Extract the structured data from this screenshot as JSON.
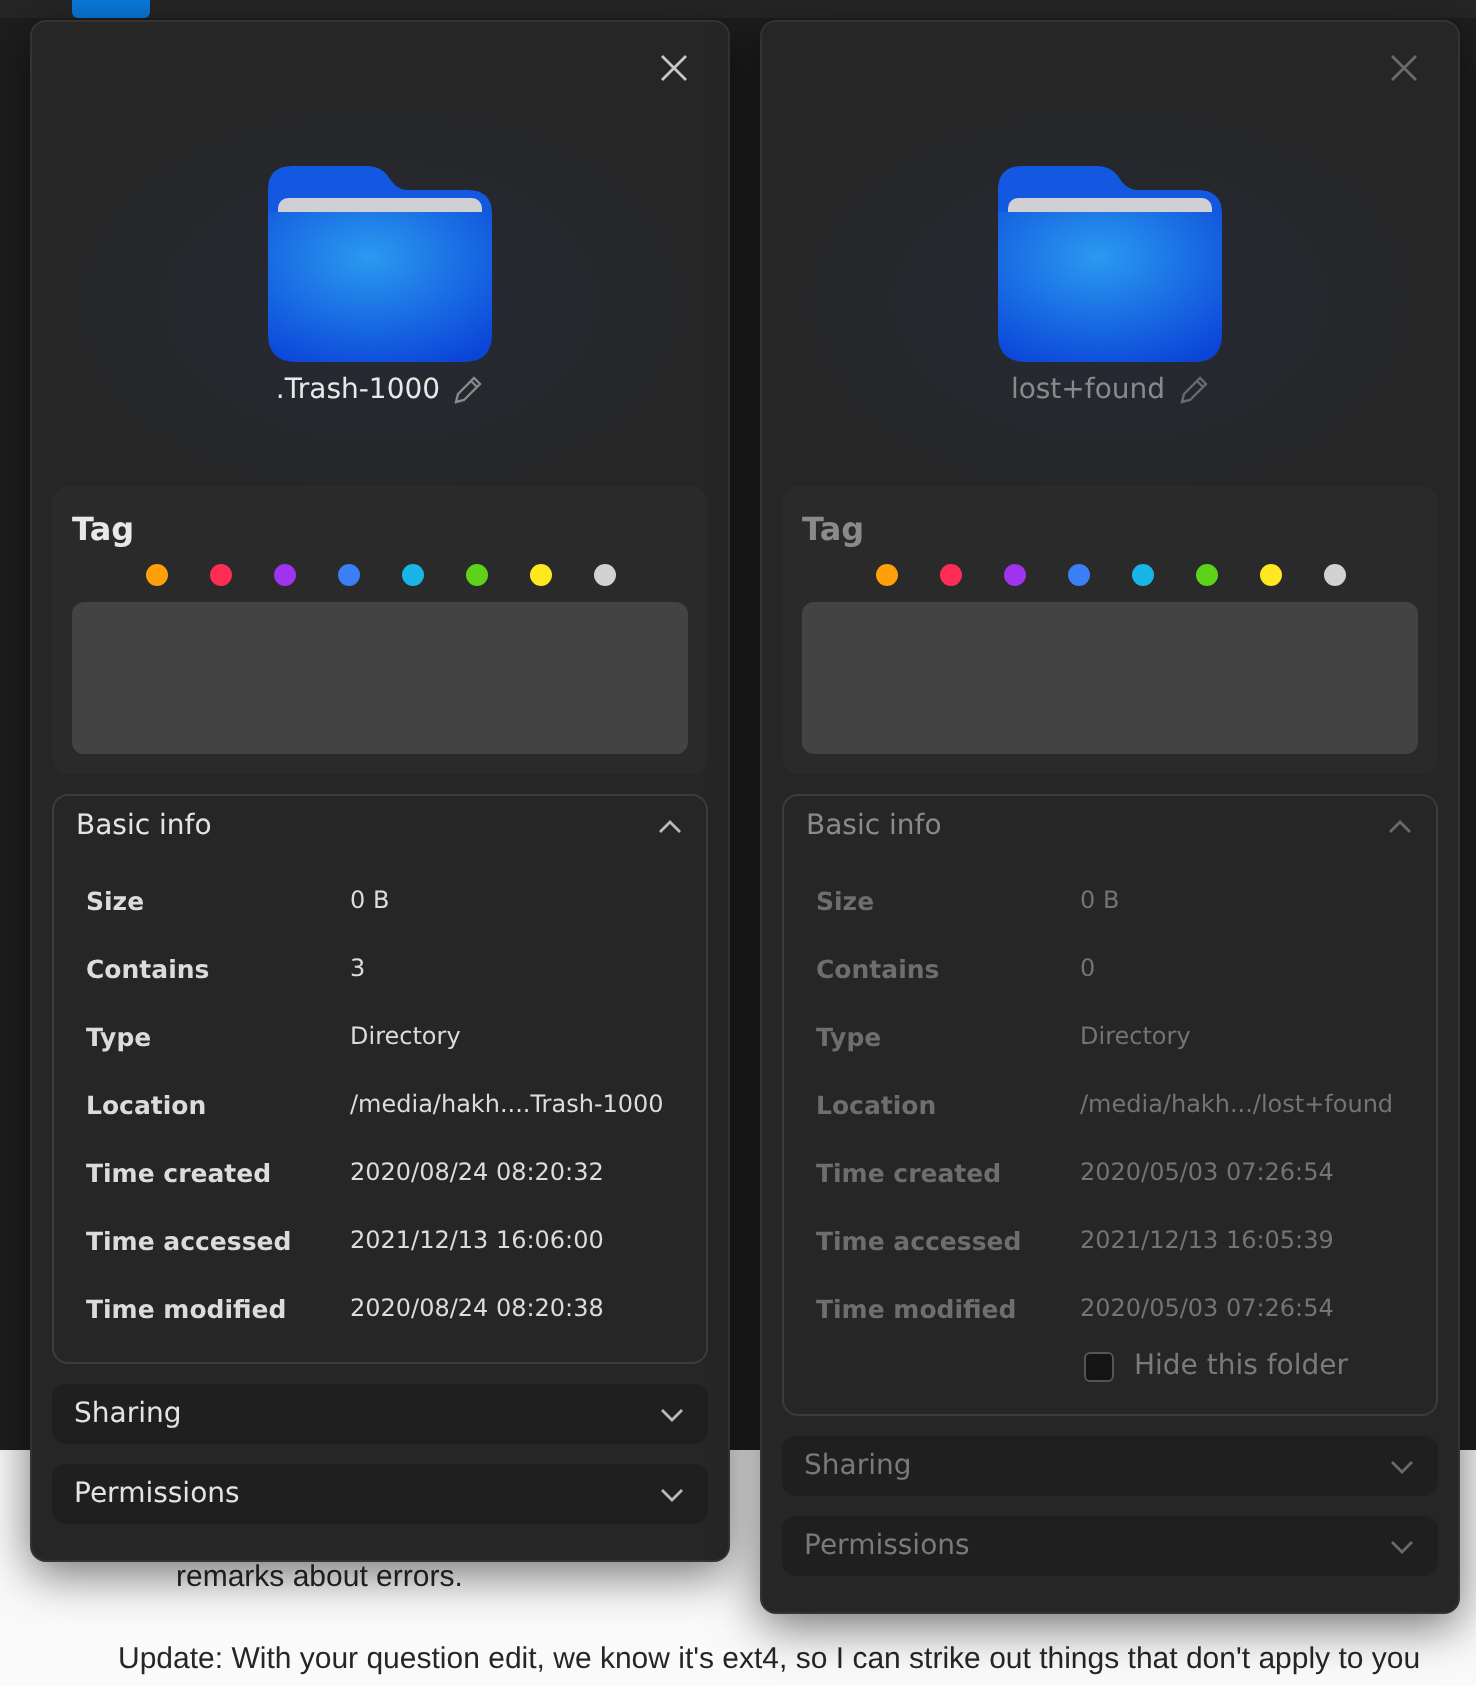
{
  "background": {
    "lines": [
      {
        "text": "remarks about errors.",
        "indent": true
      },
      {
        "text": "Update: With your question edit, we know it's ext4, so I can strike out things that don't apply to you",
        "indent": false
      }
    ]
  },
  "dialogs": [
    {
      "active": true,
      "name": ".Trash-1000",
      "tag": {
        "title": "Tag",
        "colors": [
          {
            "color": "#ff9f0a"
          },
          {
            "color": "#ff2d55"
          },
          {
            "color": "#a033f0"
          },
          {
            "color": "#3a7ff6"
          },
          {
            "color": "#19b5e8"
          },
          {
            "color": "#5ed21a"
          },
          {
            "color": "#ffe81f"
          },
          {
            "color": "#d2d2d2"
          }
        ]
      },
      "basic_info": {
        "title": "Basic info",
        "expanded": true,
        "rows": [
          {
            "label": "Size",
            "value": "0 B"
          },
          {
            "label": "Contains",
            "value": "3"
          },
          {
            "label": "Type",
            "value": "Directory"
          },
          {
            "label": "Location",
            "value": "/media/hakh....Trash-1000"
          },
          {
            "label": "Time created",
            "value": "2020/08/24 08:20:32"
          },
          {
            "label": "Time accessed",
            "value": "2021/12/13 16:06:00"
          },
          {
            "label": "Time modified",
            "value": "2020/08/24 08:20:38"
          }
        ]
      },
      "sections": [
        {
          "title": "Sharing",
          "expanded": false
        },
        {
          "title": "Permissions",
          "expanded": false
        }
      ]
    },
    {
      "active": false,
      "name": "lost+found",
      "tag": {
        "title": "Tag",
        "colors": [
          {
            "color": "#ff9f0a"
          },
          {
            "color": "#ff2d55"
          },
          {
            "color": "#a033f0"
          },
          {
            "color": "#3a7ff6"
          },
          {
            "color": "#19b5e8"
          },
          {
            "color": "#5ed21a"
          },
          {
            "color": "#ffe81f"
          },
          {
            "color": "#d2d2d2"
          }
        ]
      },
      "basic_info": {
        "title": "Basic info",
        "expanded": true,
        "rows": [
          {
            "label": "Size",
            "value": "0 B"
          },
          {
            "label": "Contains",
            "value": "0"
          },
          {
            "label": "Type",
            "value": "Directory"
          },
          {
            "label": "Location",
            "value": "/media/hakh.../lost+found"
          },
          {
            "label": "Time created",
            "value": "2020/05/03 07:26:54"
          },
          {
            "label": "Time accessed",
            "value": "2021/12/13 16:05:39"
          },
          {
            "label": "Time modified",
            "value": "2020/05/03 07:26:54"
          }
        ],
        "hide_folder": {
          "label": "Hide this folder",
          "checked": false
        }
      },
      "sections": [
        {
          "title": "Sharing",
          "expanded": false
        },
        {
          "title": "Permissions",
          "expanded": false
        }
      ]
    }
  ]
}
